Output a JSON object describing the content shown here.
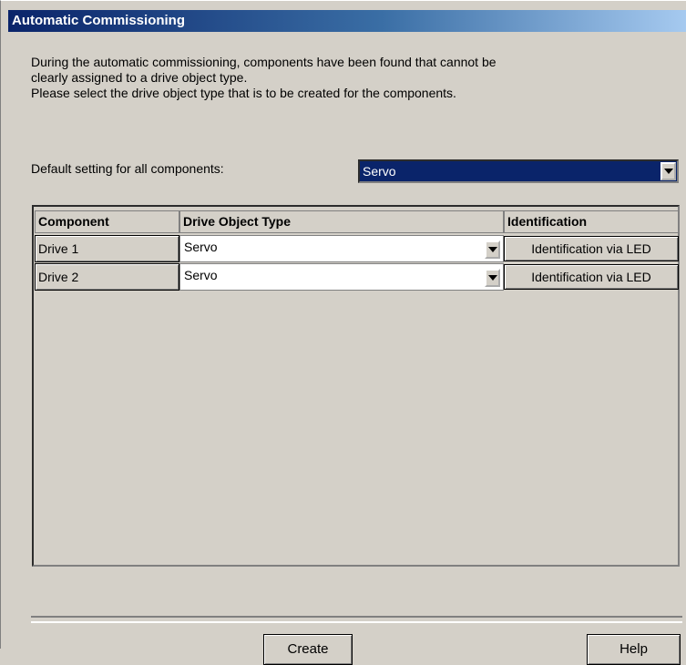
{
  "window": {
    "title": "Automatic Commissioning"
  },
  "description": {
    "line1": "During the automatic commissioning, components have been found that cannot be",
    "line2": "clearly assigned to a drive object type.",
    "line3": "Please select the drive object type that is to be created for the components."
  },
  "default_setting": {
    "label": "Default setting for all components:",
    "value": "Servo"
  },
  "table": {
    "columns": [
      "Component",
      "Drive Object Type",
      "Identification"
    ],
    "rows": [
      {
        "component": "Drive 1",
        "drive_object_type": "Servo",
        "identification": "Identification via LED"
      },
      {
        "component": "Drive 2",
        "drive_object_type": "Servo",
        "identification": "Identification via LED"
      }
    ]
  },
  "buttons": {
    "create": "Create",
    "help": "Help"
  }
}
